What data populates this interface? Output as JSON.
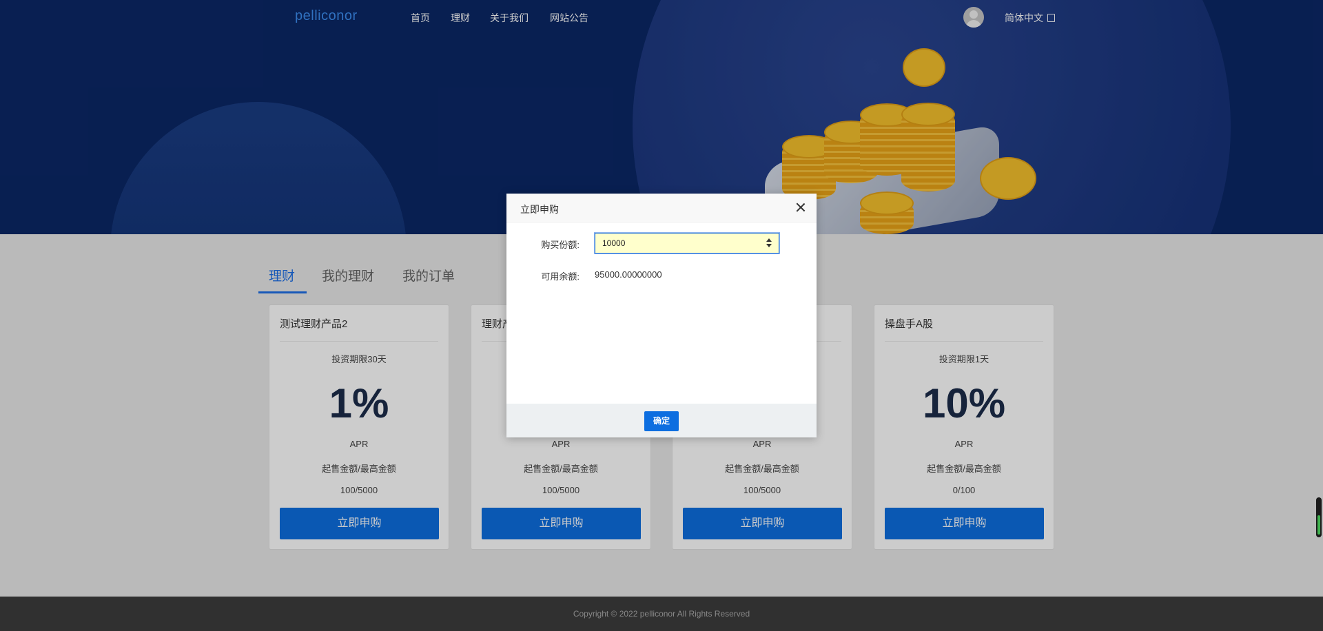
{
  "header": {
    "logo": "pelliconor",
    "nav": [
      "首页",
      "理财",
      "关于我们",
      "网站公告"
    ],
    "language": "简体中文"
  },
  "tabs": [
    "理财",
    "我的理财",
    "我的订单"
  ],
  "cards": [
    {
      "title": "测试理财产品2",
      "term": "投资期限30天",
      "rate": "1%",
      "apr": "APR",
      "minmax_label": "起售金额/最高金额",
      "minmax": "100/5000",
      "button": "立即申购"
    },
    {
      "title": "理财产",
      "term": "",
      "rate": "",
      "apr": "APR",
      "minmax_label": "起售金额/最高金额",
      "minmax": "100/5000",
      "button": "立即申购"
    },
    {
      "title": "",
      "term": "",
      "rate": "",
      "apr": "APR",
      "minmax_label": "起售金额/最高金额",
      "minmax": "100/5000",
      "button": "立即申购"
    },
    {
      "title": "操盘手A股",
      "term": "投资期限1天",
      "rate": "10%",
      "apr": "APR",
      "minmax_label": "起售金额/最高金额",
      "minmax": "0/100",
      "button": "立即申购"
    }
  ],
  "footer": {
    "copyright": "Copyright © 2022 pelliconor All Rights Reserved"
  },
  "modal": {
    "title": "立即申购",
    "quantity_label": "购买份额:",
    "quantity_value": "10000",
    "balance_label": "可用余额:",
    "balance_value": "95000.00000000",
    "confirm": "确定"
  },
  "colors": {
    "primary": "#0d6ee0",
    "hero": "#0b2766",
    "accent_blue": "#1d6ee6"
  }
}
